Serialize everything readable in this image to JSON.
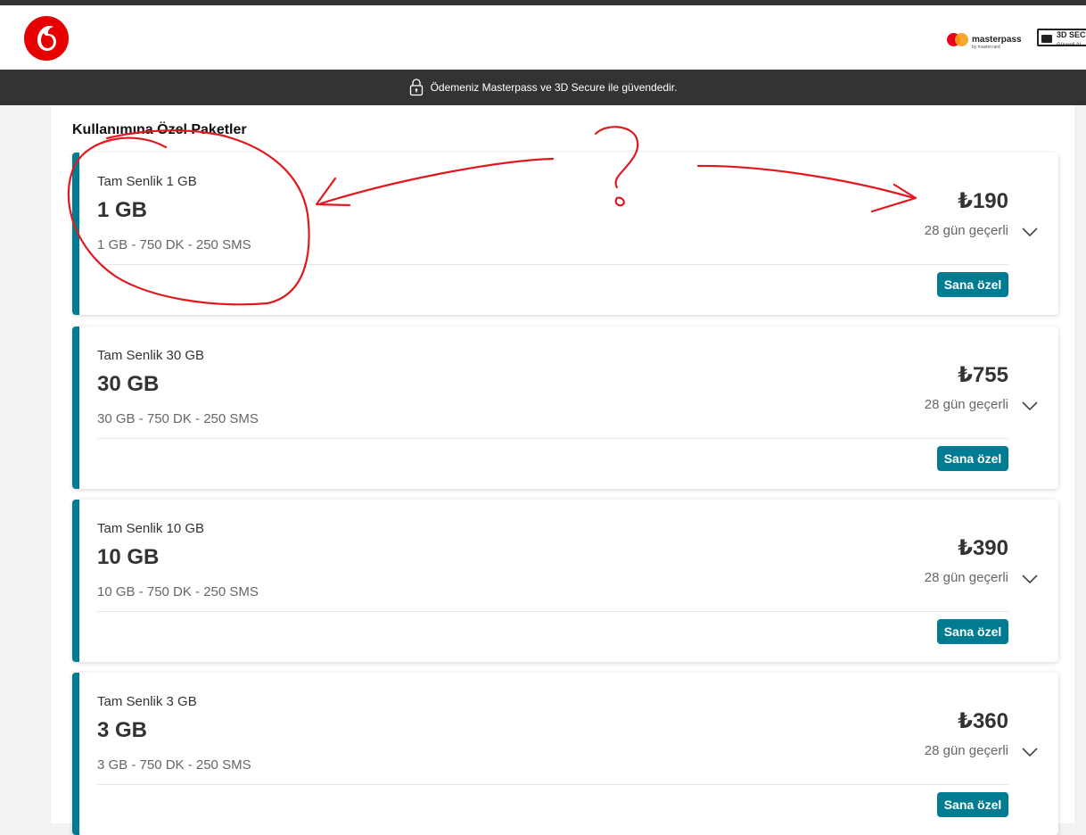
{
  "banner": {
    "text": "Ödemeniz Masterpass ve 3D Secure ile güvendedir."
  },
  "logos": {
    "masterpass": "masterpass",
    "masterpass_sub": "by mastercard",
    "secure": "3D SEC",
    "secure_sub": "Güvenli Al"
  },
  "section_title": "Kullanımına Özel Paketler",
  "packages": [
    {
      "name": "Tam Senlik 1 GB",
      "size": "1 GB",
      "desc": "1 GB - 750 DK - 250 SMS",
      "price": "₺190",
      "validity": "28 gün geçerli",
      "badge": "Sana özel"
    },
    {
      "name": "Tam Senlik 30 GB",
      "size": "30 GB",
      "desc": "30 GB - 750 DK - 250 SMS",
      "price": "₺755",
      "validity": "28 gün geçerli",
      "badge": "Sana özel"
    },
    {
      "name": "Tam Senlik 10 GB",
      "size": "10 GB",
      "desc": "10 GB - 750 DK - 250 SMS",
      "price": "₺390",
      "validity": "28 gün geçerli",
      "badge": "Sana özel"
    },
    {
      "name": "Tam Senlik 3 GB",
      "size": "3 GB",
      "desc": "3 GB - 750 DK - 250 SMS",
      "price": "₺360",
      "validity": "28 gün geçerli",
      "badge": "Sana özel"
    }
  ],
  "colors": {
    "accent": "#007c92",
    "brand_red": "#e60000",
    "annotation": "#e0191f",
    "banner_bg": "#333333"
  },
  "icons": {
    "logo": "vodafone-logo-icon",
    "lock": "lock-icon",
    "chevron": "chevron-down-icon"
  }
}
